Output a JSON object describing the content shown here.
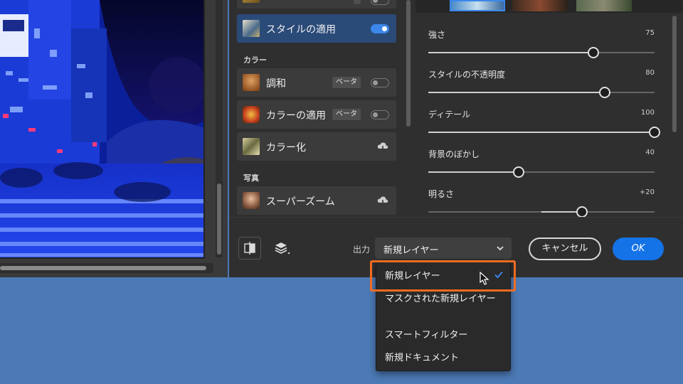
{
  "filter_list": {
    "items": [
      {
        "id": "style-transfer",
        "label": "スタイルの適用",
        "beta": false,
        "toggle": "on",
        "active": true
      },
      {
        "id": "harmonization",
        "label": "調和",
        "beta": true,
        "toggle": "off",
        "active": false
      },
      {
        "id": "color-transfer",
        "label": "カラーの適用",
        "beta": true,
        "toggle": "off",
        "active": false
      },
      {
        "id": "colorize",
        "label": "カラー化",
        "beta": false,
        "toggle": "cloud",
        "active": false
      },
      {
        "id": "super-zoom",
        "label": "スーパーズーム",
        "beta": false,
        "toggle": "cloud",
        "active": false
      }
    ],
    "sections": {
      "color": "カラー",
      "photo": "写真"
    },
    "beta_label": "ベータ"
  },
  "sliders": [
    {
      "label": "強さ",
      "value_text": "75",
      "fraction": 0.73
    },
    {
      "label": "スタイルの不透明度",
      "value_text": "80",
      "fraction": 0.78
    },
    {
      "label": "ディテール",
      "value_text": "100",
      "fraction": 1.0
    },
    {
      "label": "背景のぼかし",
      "value_text": "40",
      "fraction": 0.4
    },
    {
      "label": "明るさ",
      "value_text": "+20",
      "fraction": 0.68,
      "center_origin": true
    }
  ],
  "bottom_bar": {
    "output_label": "出力",
    "output_selected": "新規レイヤー",
    "cancel_label": "キャンセル",
    "ok_label": "OK"
  },
  "dropdown": {
    "options": [
      "新規レイヤー",
      "マスクされた新規レイヤー",
      "スマートフィルター",
      "新規ドキュメント"
    ],
    "selected_index": 0
  },
  "colors": {
    "accent_blue": "#1473e6",
    "highlight_orange": "#f26b21",
    "desktop_blue": "#4c7ab6",
    "dialog_bg": "#2f2f2f"
  },
  "icons": {
    "compare": "split-view-icon",
    "layers": "layers-icon",
    "cloud": "cloud-download-icon",
    "check": "checkmark-icon",
    "cursor": "mouse-pointer-icon"
  }
}
